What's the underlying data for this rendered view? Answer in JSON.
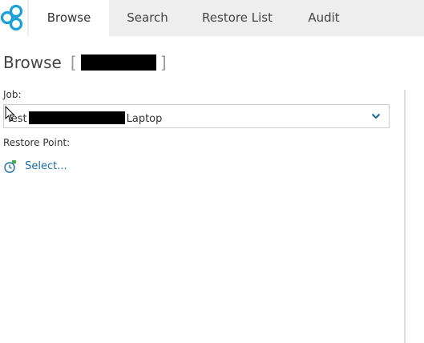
{
  "nav": {
    "tabs": [
      {
        "label": "Browse",
        "active": true
      },
      {
        "label": "Search",
        "active": false
      },
      {
        "label": "Restore List",
        "active": false
      },
      {
        "label": "Audit",
        "active": false
      }
    ]
  },
  "page": {
    "title": "Browse",
    "bracket_open": "[",
    "bracket_close": "]"
  },
  "job": {
    "label": "Job:",
    "value_prefix": "Test",
    "value_suffix": "Laptop"
  },
  "restore_point": {
    "label": "Restore Point:",
    "link_text": "Select..."
  },
  "colors": {
    "accent": "#1a6aa0",
    "logo": "#1a9fd8",
    "tab_bar": "#eeeeee"
  },
  "icons": {
    "logo": "cloud-backup-logo-icon",
    "dropdown": "chevron-down-icon",
    "restore_point": "restore-point-clock-icon",
    "cursor": "mouse-pointer-icon"
  }
}
